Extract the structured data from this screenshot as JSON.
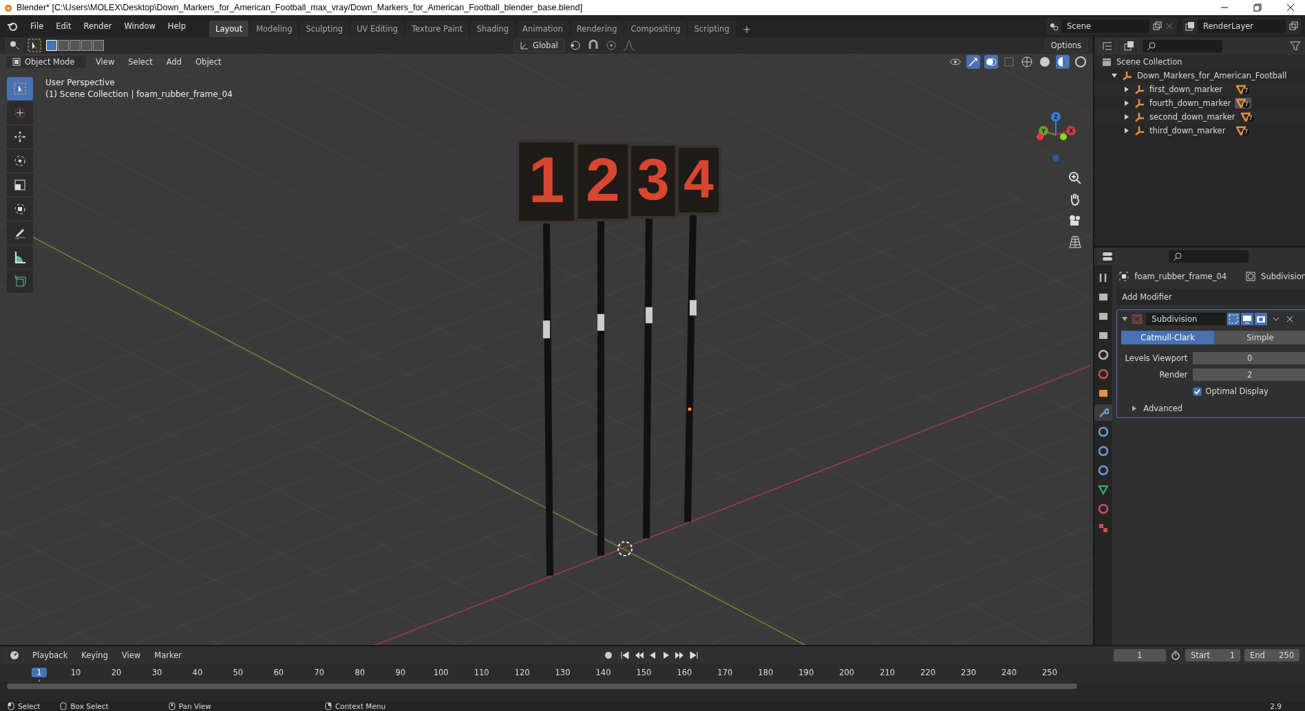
{
  "window": {
    "title": "Blender* [C:\\Users\\MOLEX\\Desktop\\Down_Markers_for_American_Football_max_vray/Down_Markers_for_American_Football_blender_base.blend]"
  },
  "menu": [
    "File",
    "Edit",
    "Render",
    "Window",
    "Help"
  ],
  "workspaces": [
    {
      "label": "Layout",
      "selected": true
    },
    {
      "label": "Modeling",
      "selected": false
    },
    {
      "label": "Sculpting",
      "selected": false
    },
    {
      "label": "UV Editing",
      "selected": false
    },
    {
      "label": "Texture Paint",
      "selected": false
    },
    {
      "label": "Shading",
      "selected": false
    },
    {
      "label": "Animation",
      "selected": false
    },
    {
      "label": "Rendering",
      "selected": false
    },
    {
      "label": "Compositing",
      "selected": false
    },
    {
      "label": "Scripting",
      "selected": false
    }
  ],
  "add_workspace": "+",
  "scene": {
    "name": "Scene",
    "view_layer": "RenderLayer"
  },
  "tool_header": {
    "orientation": "Global",
    "options": "Options"
  },
  "viewport_header": {
    "mode": "Object Mode",
    "menus": [
      "View",
      "Select",
      "Add",
      "Object"
    ]
  },
  "viewport": {
    "overlay_lines": [
      "User Perspective",
      "(1) Scene Collection | foam_rubber_frame_04"
    ],
    "marker_numbers": [
      "1",
      "2",
      "3",
      "4"
    ],
    "gizmo_axes": [
      "Z",
      "Y",
      "X"
    ]
  },
  "toolbar": [
    {
      "kind": "select",
      "selected": true
    },
    {
      "kind": "cursor",
      "selected": false
    },
    {
      "kind": "move",
      "selected": false
    },
    {
      "kind": "rotate",
      "selected": false
    },
    {
      "kind": "scale",
      "selected": false
    },
    {
      "kind": "transform",
      "selected": false
    },
    {
      "kind": "annotate",
      "selected": false
    },
    {
      "kind": "measure",
      "selected": false
    },
    {
      "kind": "add_cube",
      "selected": false
    }
  ],
  "outliner": {
    "root": "Scene Collection",
    "tree": [
      {
        "name": "Down_Markers_for_American_Football",
        "expanded": true,
        "children": [
          {
            "name": "first_down_marker",
            "expanded": false,
            "badge": "7",
            "selected": false
          },
          {
            "name": "fourth_down_marker",
            "expanded": false,
            "badge": "7",
            "selected": true
          },
          {
            "name": "second_down_marker",
            "expanded": false,
            "badge": "7",
            "selected": false
          },
          {
            "name": "third_down_marker",
            "expanded": false,
            "badge": "7",
            "selected": false
          }
        ]
      }
    ]
  },
  "properties": {
    "object": "foam_rubber_frame_04",
    "modifier_crumb": "Subdivision",
    "add_modifier": "Add Modifier",
    "tabs": [
      {
        "kind": "tool",
        "selected": false
      },
      {
        "kind": "render",
        "selected": false
      },
      {
        "kind": "output",
        "selected": false
      },
      {
        "kind": "view_layer",
        "selected": false
      },
      {
        "kind": "scene",
        "selected": false
      },
      {
        "kind": "world",
        "selected": false
      },
      {
        "kind": "object",
        "selected": false
      },
      {
        "kind": "modifier",
        "selected": true
      },
      {
        "kind": "particles",
        "selected": false
      },
      {
        "kind": "physics",
        "selected": false
      },
      {
        "kind": "constraints",
        "selected": false
      },
      {
        "kind": "data",
        "selected": false
      },
      {
        "kind": "material",
        "selected": false
      },
      {
        "kind": "texture",
        "selected": false
      }
    ],
    "modifier": {
      "name": "Subdivision",
      "expanded": true,
      "methods": [
        {
          "label": "Catmull-Clark",
          "selected": true
        },
        {
          "label": "Simple",
          "selected": false
        }
      ],
      "fields": [
        {
          "label": "Levels Viewport",
          "value": "0"
        },
        {
          "label": "Render",
          "value": "2"
        }
      ],
      "optimal_display": {
        "label": "Optimal Display",
        "checked": true
      },
      "advanced": {
        "label": "Advanced",
        "expanded": false
      }
    }
  },
  "timeline": {
    "menus": [
      "Playback",
      "Keying",
      "View",
      "Marker"
    ],
    "current_frame": "1",
    "start_label": "Start",
    "start": "1",
    "end_label": "End",
    "end": "250",
    "ruler": [
      {
        "label": "1",
        "selected": true
      },
      {
        "label": "10",
        "selected": false
      },
      {
        "label": "20",
        "selected": false
      },
      {
        "label": "30",
        "selected": false
      },
      {
        "label": "40",
        "selected": false
      },
      {
        "label": "50",
        "selected": false
      },
      {
        "label": "60",
        "selected": false
      },
      {
        "label": "70",
        "selected": false
      },
      {
        "label": "80",
        "selected": false
      },
      {
        "label": "90",
        "selected": false
      },
      {
        "label": "100",
        "selected": false
      },
      {
        "label": "110",
        "selected": false
      },
      {
        "label": "120",
        "selected": false
      },
      {
        "label": "130",
        "selected": false
      },
      {
        "label": "140",
        "selected": false
      },
      {
        "label": "150",
        "selected": false
      },
      {
        "label": "160",
        "selected": false
      },
      {
        "label": "170",
        "selected": false
      },
      {
        "label": "180",
        "selected": false
      },
      {
        "label": "190",
        "selected": false
      },
      {
        "label": "200",
        "selected": false
      },
      {
        "label": "210",
        "selected": false
      },
      {
        "label": "220",
        "selected": false
      },
      {
        "label": "230",
        "selected": false
      },
      {
        "label": "240",
        "selected": false
      },
      {
        "label": "250",
        "selected": false
      }
    ]
  },
  "status_bar": {
    "items": [
      "Select",
      "Box Select",
      "Pan View",
      "Context Menu"
    ],
    "version": "2.9"
  }
}
